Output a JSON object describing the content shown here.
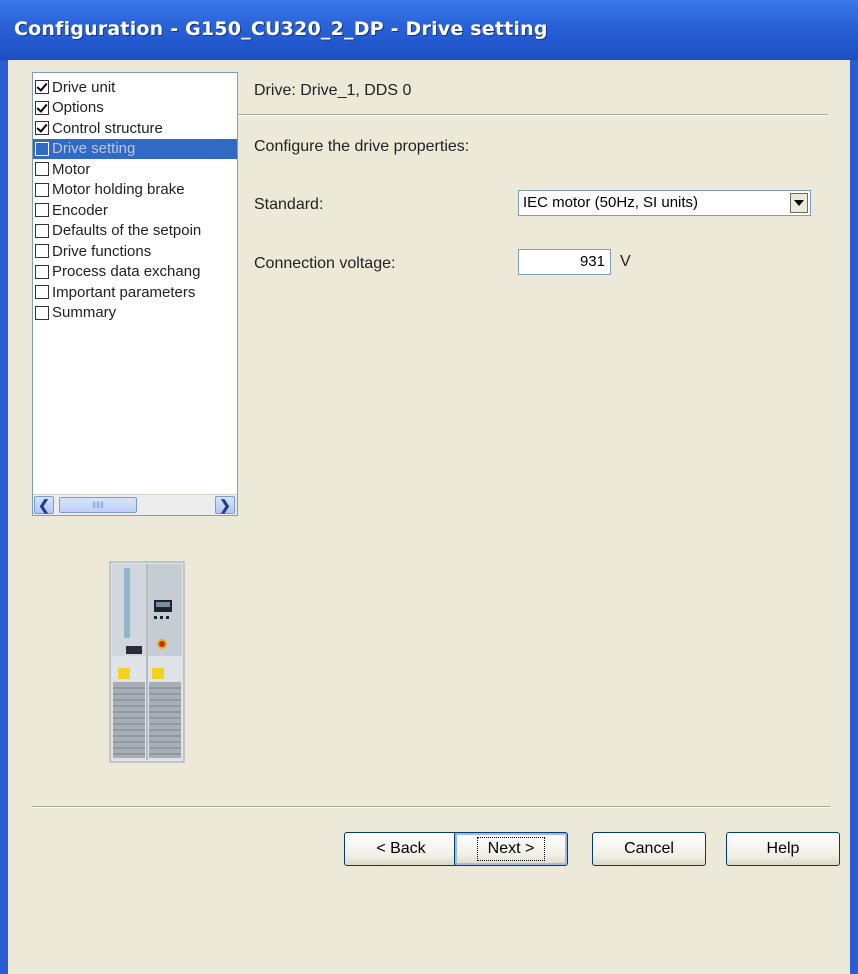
{
  "window": {
    "title": "Configuration - G150_CU320_2_DP - Drive setting"
  },
  "tree": {
    "items": [
      {
        "label": "Drive unit",
        "checked": true,
        "selected": false
      },
      {
        "label": "Options",
        "checked": true,
        "selected": false
      },
      {
        "label": "Control structure",
        "checked": true,
        "selected": false
      },
      {
        "label": "Drive setting",
        "checked": false,
        "selected": true
      },
      {
        "label": "Motor",
        "checked": false,
        "selected": false
      },
      {
        "label": "Motor holding brake",
        "checked": false,
        "selected": false
      },
      {
        "label": "Encoder",
        "checked": false,
        "selected": false
      },
      {
        "label": "Defaults of the setpoin",
        "checked": false,
        "selected": false
      },
      {
        "label": "Drive functions",
        "checked": false,
        "selected": false
      },
      {
        "label": "Process data exchang",
        "checked": false,
        "selected": false
      },
      {
        "label": "Important parameters",
        "checked": false,
        "selected": false
      },
      {
        "label": "Summary",
        "checked": false,
        "selected": false
      }
    ]
  },
  "panel": {
    "heading": "Drive: Drive_1, DDS 0",
    "prompt": "Configure the drive properties:",
    "standard_label": "Standard:",
    "standard_value": "IEC motor (50Hz, SI units)",
    "voltage_label": "Connection voltage:",
    "voltage_value": "931",
    "voltage_unit": "V"
  },
  "buttons": {
    "back": "< Back",
    "next": "Next >",
    "cancel": "Cancel",
    "help": "Help"
  },
  "colors": {
    "titlebar": "#2a63d8",
    "dialog_bg": "#ece9d8",
    "selection": "#316ac5"
  }
}
